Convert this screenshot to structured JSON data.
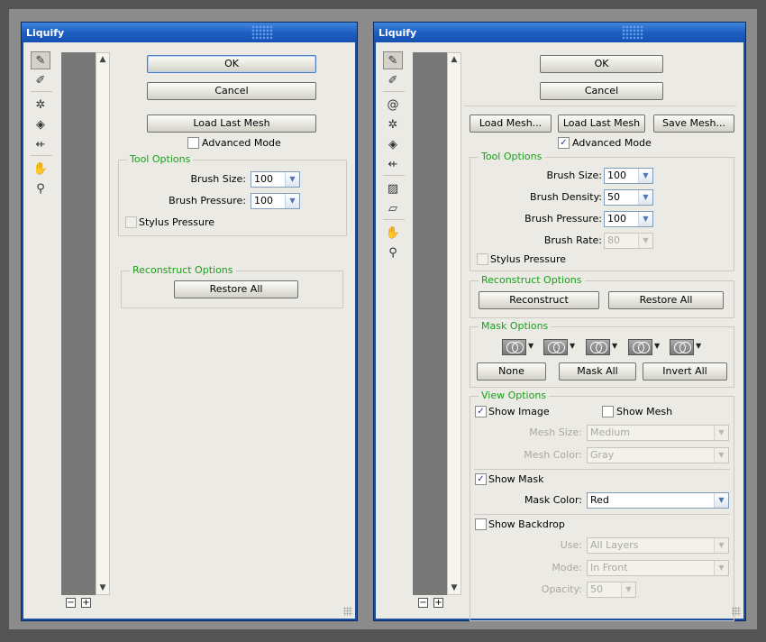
{
  "left_window": {
    "title": "Liquify",
    "ok_label": "OK",
    "cancel_label": "Cancel",
    "load_last_mesh_label": "Load Last Mesh",
    "advanced_mode_label": "Advanced Mode",
    "advanced_mode_checked": false,
    "tool_options": {
      "title": "Tool Options",
      "brush_size_label": "Brush Size:",
      "brush_size_value": "100",
      "brush_pressure_label": "Brush Pressure:",
      "brush_pressure_value": "100",
      "stylus_pressure_label": "Stylus Pressure"
    },
    "reconstruct_options": {
      "title": "Reconstruct Options",
      "restore_all_label": "Restore All"
    },
    "zoom_out_label": "−",
    "zoom_in_label": "+"
  },
  "right_window": {
    "title": "Liquify",
    "ok_label": "OK",
    "cancel_label": "Cancel",
    "load_mesh_label": "Load Mesh...",
    "load_last_mesh_label": "Load Last Mesh",
    "save_mesh_label": "Save Mesh...",
    "advanced_mode_label": "Advanced Mode",
    "advanced_mode_checked": true,
    "tool_options": {
      "title": "Tool Options",
      "brush_size_label": "Brush Size:",
      "brush_size_value": "100",
      "brush_density_label": "Brush Density:",
      "brush_density_value": "50",
      "brush_pressure_label": "Brush Pressure:",
      "brush_pressure_value": "100",
      "brush_rate_label": "Brush Rate:",
      "brush_rate_value": "80",
      "stylus_pressure_label": "Stylus Pressure"
    },
    "reconstruct_options": {
      "title": "Reconstruct Options",
      "reconstruct_label": "Reconstruct",
      "restore_all_label": "Restore All"
    },
    "mask_options": {
      "title": "Mask Options",
      "none_label": "None",
      "mask_all_label": "Mask All",
      "invert_all_label": "Invert All"
    },
    "view_options": {
      "title": "View Options",
      "show_image_label": "Show Image",
      "show_image_checked": true,
      "show_mesh_label": "Show Mesh",
      "show_mesh_checked": false,
      "mesh_size_label": "Mesh Size:",
      "mesh_size_value": "Medium",
      "mesh_color_label": "Mesh Color:",
      "mesh_color_value": "Gray",
      "show_mask_label": "Show Mask",
      "show_mask_checked": true,
      "mask_color_label": "Mask Color:",
      "mask_color_value": "Red",
      "show_backdrop_label": "Show Backdrop",
      "show_backdrop_checked": false,
      "use_label": "Use:",
      "use_value": "All Layers",
      "mode_label": "Mode:",
      "mode_value": "In Front",
      "opacity_label": "Opacity:",
      "opacity_value": "50"
    },
    "zoom_out_label": "−",
    "zoom_in_label": "+"
  },
  "icons": {
    "forward_warp": "forward-warp-icon",
    "reconstruct": "reconstruct-tool-icon",
    "twirl": "twirl-icon",
    "pucker": "pucker-icon",
    "bloat": "bloat-icon",
    "push_left": "push-left-icon",
    "freeze_mask": "freeze-mask-icon",
    "thaw_mask": "thaw-mask-icon",
    "hand": "hand-icon",
    "zoom": "zoom-icon"
  },
  "colors": {
    "titlebar": "#1f5fc2",
    "panel_bg": "#ebeae4",
    "group_title": "#1b9f1b",
    "preview": "#777777"
  }
}
